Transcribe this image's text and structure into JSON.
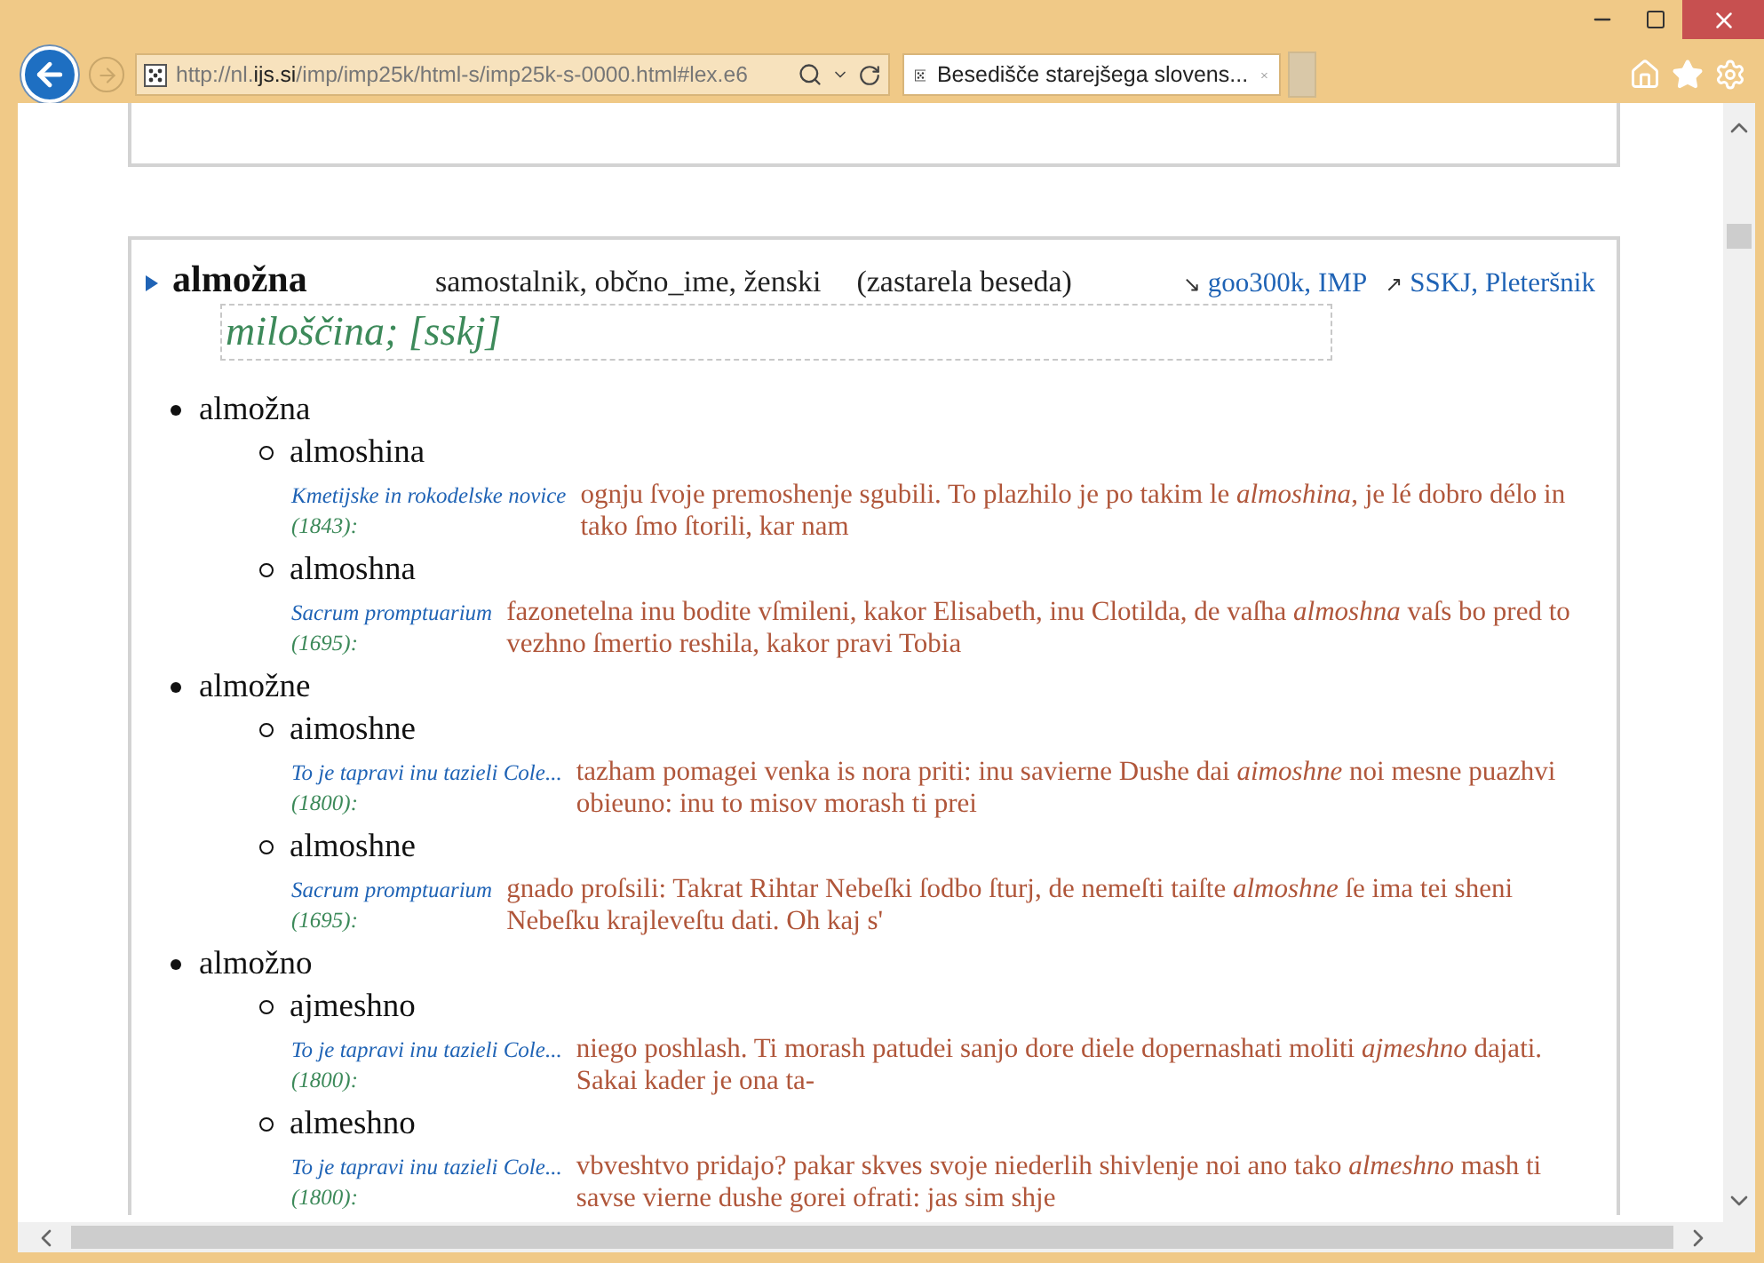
{
  "browser": {
    "address": {
      "before": "http://nl.",
      "domain": "ijs.si",
      "after": "/imp/imp25k/html-s/imp25k-s-0000.html#lex.e6"
    },
    "tabs": [
      {
        "title": "Besedišče starejšega slovens...",
        "selected": true
      }
    ]
  },
  "entry": {
    "headword": "almožna",
    "grammar": "samostalnik, občno_ime, ženski",
    "note": "(zastarela beseda)",
    "link_groups": [
      {
        "arrow": "↘",
        "separator": ",",
        "links": [
          "goo300k",
          "IMP"
        ]
      },
      {
        "arrow": "↗",
        "separator": ",",
        "links": [
          "SSKJ",
          "Pleteršnik"
        ]
      }
    ],
    "definition": "miloščina; [sskj]",
    "lemmas": [
      {
        "form": "almožna",
        "variants": [
          {
            "form": "almoshina",
            "source": "Kmetijske in rokodelske novice",
            "year": "(1843):",
            "quote": "ognju ſvoje premoshenje sgubili. To plazhilo je po takim le *almoshina*, je lé dobro délo in tako ſmo ſtorili, kar nam"
          },
          {
            "form": "almoshna",
            "source": "Sacrum promptuarium",
            "year": "(1695):",
            "quote": "fazonetelna inu bodite vſmileni, kakor Elisabeth, inu Clotilda, de vaſha *almoshna* vaſs bo pred to vezhno ſmertio reshila, kakor pravi Tobia"
          }
        ]
      },
      {
        "form": "almožne",
        "variants": [
          {
            "form": "aimoshne",
            "source": "To je tapravi inu tazieli Cole...",
            "year": "(1800):",
            "quote": "tazham pomagei venka is nora priti: inu savierne Dushe dai *aimoshne* noi mesne puazhvi obieuno: inu to misov morash ti prei"
          },
          {
            "form": "almoshne",
            "source": "Sacrum promptuarium",
            "year": "(1695):",
            "quote": "gnado proſsili: Takrat Rihtar Nebeſki ſodbo ſturj, de nemeſti taiſte *almoshne* ſe ima tei sheni Nebeſku krajleveſtu dati. Oh kaj s'"
          }
        ]
      },
      {
        "form": "almožno",
        "variants": [
          {
            "form": "ajmeshno",
            "source": "To je tapravi inu tazieli Cole...",
            "year": "(1800):",
            "quote": "niego poshlash. Ti morash patudei sanjo dore diele dopernashati moliti *ajmeshno* dajati. Sakai kader je ona ta-"
          },
          {
            "form": "almeshno",
            "source": "To je tapravi inu tazieli Cole...",
            "year": "(1800):",
            "quote": "vbveshtvo pridajo? pakar skves svoje niederlih shivlenje noi ano tako *almeshno* mash ti savse vierne dushe gorei ofrati: jas sim shje"
          }
        ]
      }
    ]
  }
}
